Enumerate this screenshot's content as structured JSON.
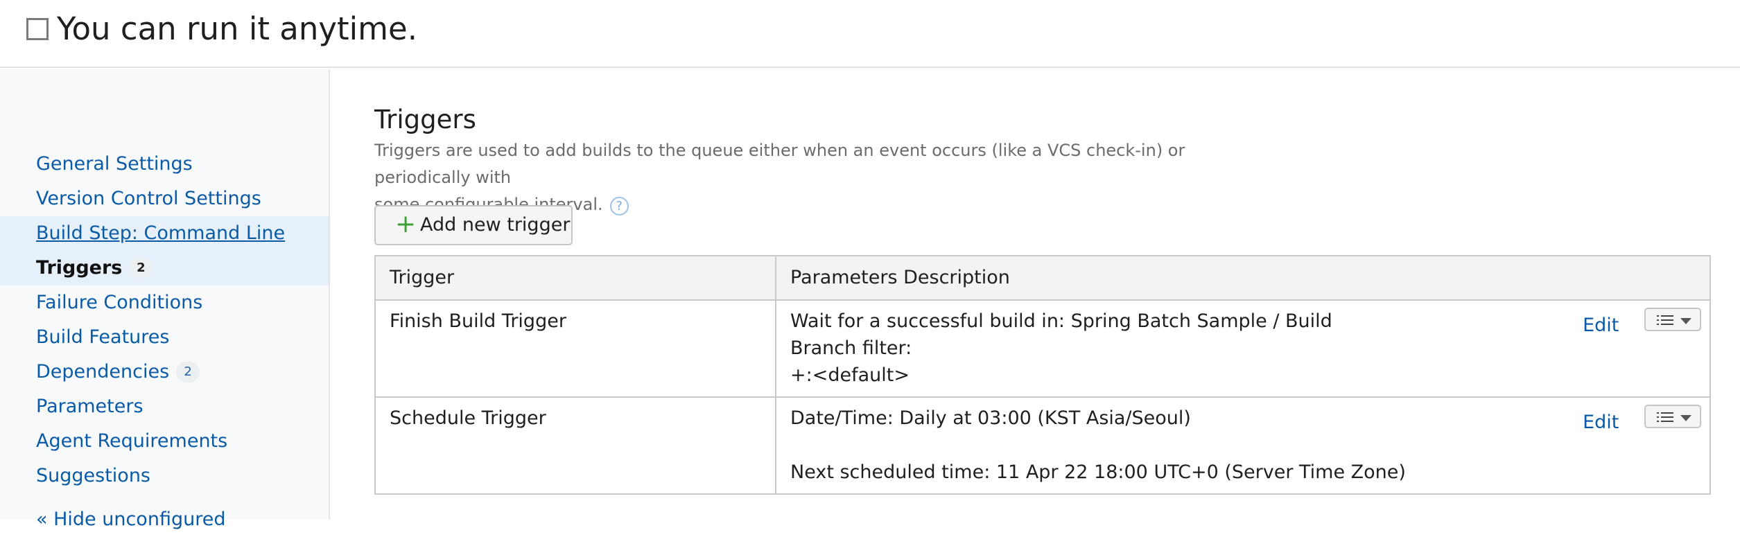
{
  "header": {
    "title": "You can run it anytime."
  },
  "sidebar": {
    "items": [
      {
        "label": "General Settings"
      },
      {
        "label": "Version Control Settings"
      },
      {
        "label": "Build Step: Command Line"
      },
      {
        "label": "Triggers",
        "count": "2"
      },
      {
        "label": "Failure Conditions"
      },
      {
        "label": "Build Features"
      },
      {
        "label": "Dependencies",
        "count": "2"
      },
      {
        "label": "Parameters"
      },
      {
        "label": "Agent Requirements"
      },
      {
        "label": "Suggestions"
      }
    ],
    "hide_unconfigured": "« Hide unconfigured"
  },
  "main": {
    "heading": "Triggers",
    "description_line1": "Triggers are used to add builds to the queue either when an event occurs (like a VCS check-in) or periodically with",
    "description_line2": "some configurable interval.",
    "help_icon": "?",
    "add_button": {
      "icon": "+",
      "label": "Add new trigger"
    },
    "table": {
      "headers": [
        "Trigger",
        "Parameters Description"
      ],
      "rows": [
        {
          "trigger": "Finish Build Trigger",
          "lines": [
            "Wait for a successful build in: Spring Batch Sample / Build",
            "Branch filter:",
            "+:<default>"
          ],
          "edit": "Edit"
        },
        {
          "trigger": "Schedule Trigger",
          "lines": [
            "Date/Time: Daily at 03:00 (KST Asia/Seoul)",
            "",
            "Next scheduled time: 11 Apr 22 18:00 UTC+0 (Server Time Zone)"
          ],
          "edit": "Edit"
        }
      ]
    }
  },
  "colors": {
    "link": "#0b5aa6",
    "plus": "#3ca034",
    "active_bg": "#e6f0fb"
  },
  "icons": {
    "checkbox": "checkbox-icon",
    "plus": "plus-icon",
    "help": "help-icon",
    "menu": "list-menu-icon"
  }
}
